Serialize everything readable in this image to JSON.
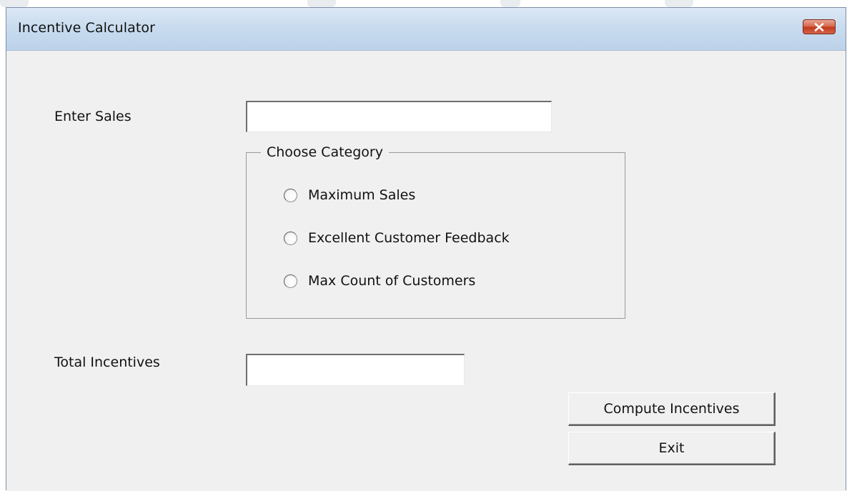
{
  "window": {
    "title": "Incentive Calculator"
  },
  "form": {
    "sales_label": "Enter Sales",
    "sales_value": "",
    "total_label": "Total Incentives",
    "total_value": ""
  },
  "category": {
    "caption": "Choose Category",
    "options": [
      {
        "label": "Maximum Sales",
        "selected": false
      },
      {
        "label": "Excellent Customer Feedback",
        "selected": false
      },
      {
        "label": "Max Count of Customers",
        "selected": false
      }
    ]
  },
  "buttons": {
    "compute_label": "Compute Incentives",
    "exit_label": "Exit"
  },
  "icons": {
    "close": "close-icon"
  },
  "colors": {
    "titlebar": "#c9dcef",
    "client_background": "#f0f0f0",
    "close_button": "#c2381b"
  }
}
